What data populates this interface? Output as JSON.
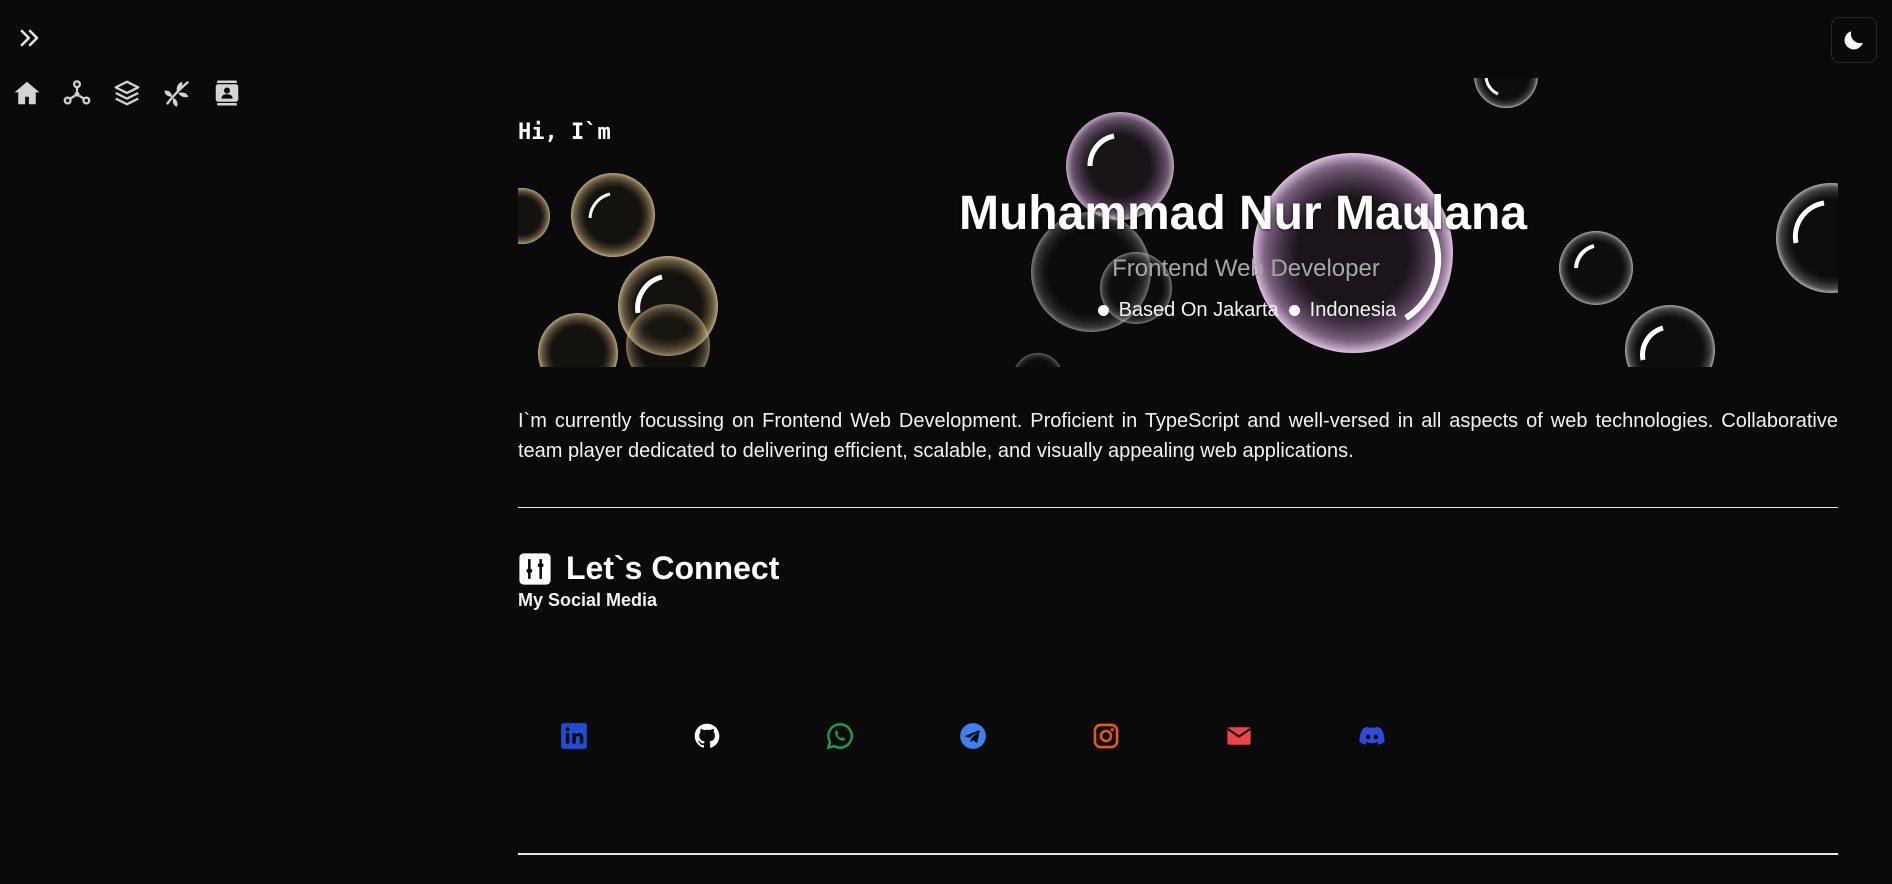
{
  "hero": {
    "greeting": "Hi, I`m",
    "name": "Muhammad Nur Maulana",
    "role": "Frontend Web Developer",
    "location_city": "Based On Jakarta",
    "location_country": "Indonesia"
  },
  "intro": "I`m currently focussing on Frontend Web Development. Proficient in TypeScript and well-versed in all aspects of web technologies. Collaborative team player dedicated to delivering efficient, scalable, and visually appealing web applications.",
  "connect": {
    "title": "Let`s Connect",
    "subtitle": "My Social Media"
  },
  "nav": {
    "items": [
      {
        "icon": "home-icon"
      },
      {
        "icon": "network-icon"
      },
      {
        "icon": "layers-icon"
      },
      {
        "icon": "leaf-branch-icon"
      },
      {
        "icon": "contact-card-icon"
      }
    ]
  },
  "socials": [
    {
      "icon": "linkedin-icon",
      "color": "#1d4ed8"
    },
    {
      "icon": "github-icon",
      "color": "#ffffff"
    },
    {
      "icon": "whatsapp-icon",
      "color": "#16a34a"
    },
    {
      "icon": "telegram-icon",
      "color": "#3b82f6"
    },
    {
      "icon": "instagram-icon",
      "color": "#ea580c"
    },
    {
      "icon": "mail-icon",
      "color": "#ef4444"
    },
    {
      "icon": "discord-icon",
      "color": "#2f4ad8"
    }
  ],
  "theme": {
    "icon": "moon-icon"
  },
  "colors": {
    "background": "#0a0a0a",
    "text": "#f2f2f2",
    "muted": "#a6a6a6"
  }
}
